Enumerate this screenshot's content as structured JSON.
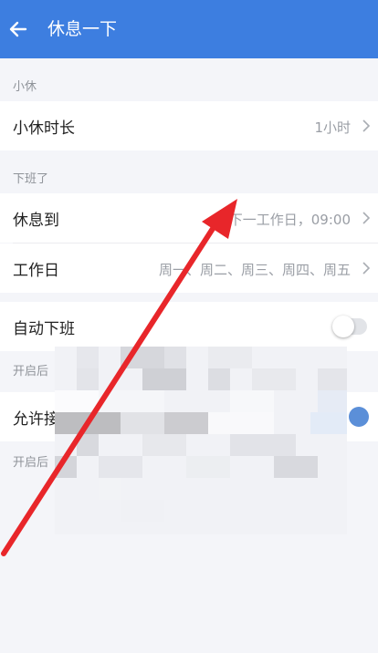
{
  "header": {
    "title": "休息一下"
  },
  "sections": {
    "rest": {
      "label": "小休",
      "duration": {
        "label": "小休时长",
        "value": "1小时"
      }
    },
    "offwork": {
      "label": "下班了",
      "rest_until": {
        "label": "休息到",
        "value": "下一工作日，09:00"
      },
      "workdays": {
        "label": "工作日",
        "value": "周一、周二、周三、周四、周五"
      }
    },
    "auto_offwork": {
      "label": "自动下班",
      "enabled": false,
      "hint": "开启后"
    },
    "allow": {
      "label": "允许接",
      "enabled": true,
      "hint": "开启后"
    }
  },
  "colors": {
    "header_bg": "#3d7ee0",
    "toggle_on": "#5b8fd8",
    "arrow": "#e8262a"
  }
}
